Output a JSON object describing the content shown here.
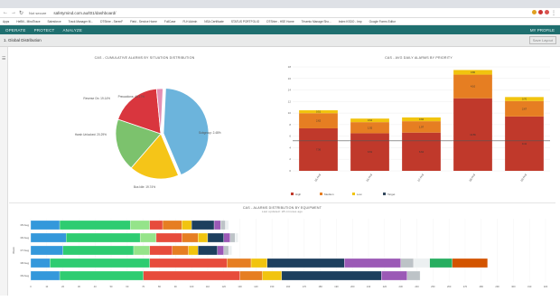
{
  "browser": {
    "security_label": "Not secure",
    "url": "safetymind.com.au/t01/dashboard/",
    "bookmarks": [
      "Apps",
      "HeBN - MindTrace",
      "Salesforce",
      "Track Manager M...",
      "DTShire - SerenF",
      "Field - Service Home",
      "FullCase",
      "FLH Admin",
      "NSA Certificate",
      "STATUS PORTFOLIO",
      "DTShire - HSE Home",
      "Trisento Manage Sho...",
      "Index KSDO - Imp",
      "Google Forms Editor"
    ]
  },
  "app": {
    "menu": [
      "OPERATE",
      "PROTECT",
      "ANALYZE"
    ],
    "profile": "MY PROFILE",
    "breadcrumb": "1. Global Distribution",
    "save_layout": "Save Layout"
  },
  "pie": {
    "title": "CAS - CUMULATIVE ALARMS BY SITUATION DISTRIBUTION",
    "labels": [
      "Subgroup: 2.48%",
      "Bus Idle: 19.74%",
      "Harsh Unlocked: 20.29%",
      "Reverse On: 19.14%",
      "Precautions: 46.17%"
    ]
  },
  "stacked_bar": {
    "title": "CAS - AVG DAILY ALARMS BY PRIORITY",
    "legend": [
      "High",
      "Medium",
      "Low",
      "Target"
    ]
  },
  "hbar": {
    "title": "CAS - ALARMS DISTRIBUTION BY EQUIPMENT",
    "subtitle": "Last updated: 28 minutes ago",
    "ylabel": "Week"
  },
  "chart_data": [
    {
      "type": "pie",
      "title": "CAS - CUMULATIVE ALARMS BY SITUATION DISTRIBUTION",
      "slices": [
        {
          "label": "Precautions",
          "value": 46.17,
          "color": "#6cb4dc"
        },
        {
          "label": "Reverse On",
          "value": 19.14,
          "color": "#f5c518"
        },
        {
          "label": "Harsh Unlocked",
          "value": 20.29,
          "color": "#7cc26d"
        },
        {
          "label": "Bus Idle",
          "value": 19.74,
          "color": "#d9363e"
        },
        {
          "label": "Subgroup",
          "value": 2.48,
          "color": "#e48fb4"
        }
      ]
    },
    {
      "type": "bar",
      "title": "CAS - AVG DAILY ALARMS BY PRIORITY",
      "categories": [
        "05 Aug",
        "06 Aug",
        "07 Aug",
        "08 Aug",
        "09 Aug"
      ],
      "ylim": [
        0,
        18
      ],
      "yticks": [
        0,
        2,
        4,
        6,
        8,
        10,
        12,
        14,
        16,
        18
      ],
      "target": 5.2,
      "series": [
        {
          "name": "High",
          "color": "#c0392b",
          "values": [
            7.36,
            6.51,
            6.62,
            12.56,
            9.41
          ],
          "labels": [
            "7.36",
            "6.51",
            "6.62",
            "12.56",
            "9.41"
          ]
        },
        {
          "name": "Medium",
          "color": "#e67e22",
          "values": [
            2.62,
            1.92,
            1.97,
            4.1,
            2.67
          ],
          "labels": [
            "2.62",
            "1.92",
            "1.97",
            "4.10",
            "2.67"
          ]
        },
        {
          "name": "Low",
          "color": "#f1c40f",
          "values": [
            0.51,
            0.62,
            0.66,
            0.8,
            0.7
          ],
          "labels": [
            "0.51",
            "0.62",
            "0.66",
            "0.80",
            "0.70"
          ]
        }
      ]
    },
    {
      "type": "bar",
      "orientation": "horizontal",
      "title": "CAS - ALARMS DISTRIBUTION BY EQUIPMENT",
      "categories": [
        "05 Aug",
        "06 Aug",
        "07 Aug",
        "08 Aug",
        "09 Aug"
      ],
      "xlim": [
        0,
        320
      ],
      "xticks": [
        0,
        10,
        20,
        30,
        40,
        50,
        60,
        70,
        80,
        90,
        100,
        110,
        120,
        130,
        140,
        150,
        160,
        170,
        180,
        190,
        200,
        210,
        220,
        230,
        240,
        250,
        260,
        270,
        280,
        290,
        300,
        310,
        320
      ],
      "segment_colors": [
        "#3498db",
        "#2ecc71",
        "#95e48a",
        "#e74c3c",
        "#e67e22",
        "#f1c40f",
        "#1d3f5e",
        "#9b59b6",
        "#bdc3c7",
        "#ecf0f1",
        "#27ae60",
        "#d35400"
      ],
      "rows": [
        [
          18,
          44,
          12,
          8,
          12,
          6,
          14,
          4,
          3,
          2,
          0,
          0
        ],
        [
          22,
          46,
          10,
          16,
          10,
          6,
          10,
          4,
          3,
          2,
          0,
          0
        ],
        [
          20,
          44,
          10,
          14,
          10,
          6,
          12,
          4,
          3,
          2,
          0,
          0
        ],
        [
          12,
          62,
          0,
          48,
          15,
          10,
          48,
          35,
          8,
          10,
          14,
          22
        ],
        [
          18,
          52,
          0,
          60,
          14,
          12,
          62,
          16,
          8,
          0,
          0,
          0
        ]
      ]
    }
  ]
}
